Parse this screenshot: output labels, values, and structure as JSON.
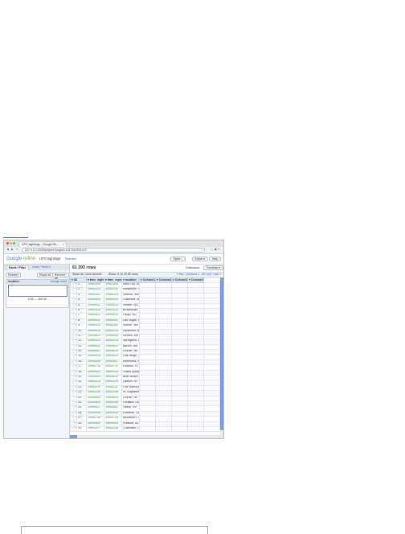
{
  "browser": {
    "tab_title": "UFO sightings - Google Re...",
    "url": "127.0.0.1:3333/project?project=1417510931470"
  },
  "app": {
    "brand_google": "Google",
    "brand_refine": "refine",
    "project_name": "UFO sightings",
    "permalink": "Permalink",
    "buttons": {
      "open": "Open...",
      "export": "Export ▾",
      "help": "Help"
    }
  },
  "left": {
    "tabs": [
      "Facet / Filter",
      "Undo / Redo 0"
    ],
    "refresh": "Refresh",
    "reset_all": "Reset All",
    "remove_all": "Remove All",
    "facet": {
      "title": "location",
      "links": "change  reset",
      "range": "0.00 — 400.00"
    }
  },
  "main": {
    "rows_count": "61 393 rows",
    "view_buttons": [
      "Extensions:",
      "Freebase ▾"
    ],
    "show_as": "Show as: rows records",
    "show_count": "Show: 5 10 25 50 rows",
    "paging": "« first ‹ previous 1 - 50 next › last »",
    "columns": [
      "All",
      "time_sighted",
      "time_reported",
      "location",
      "Column1",
      "Column2",
      "Column3",
      "Column4",
      "Column5"
    ],
    "rows": [
      {
        "n": "1.",
        "sighted": "19951009",
        "reported": "19951009",
        "location": "Iowa City, IA"
      },
      {
        "n": "2.",
        "sighted": "19951010",
        "reported": "19951011",
        "location": "Milwaukee, WI"
      },
      {
        "n": "3.",
        "sighted": "19950101",
        "reported": "19950103",
        "location": "Shelton, WA"
      },
      {
        "n": "4.",
        "sighted": "19950510",
        "reported": "19950510",
        "location": "Columbia, MO"
      },
      {
        "n": "5.",
        "sighted": "19950611",
        "reported": "19950614",
        "location": "Seattle, WA"
      },
      {
        "n": "6.",
        "sighted": "19951025",
        "reported": "19951024",
        "location": "Brownsville, WA"
      },
      {
        "n": "7.",
        "sighted": "19950620",
        "reported": "19950619",
        "location": "Fargo, ND"
      },
      {
        "n": "8.",
        "sighted": "19950911",
        "reported": "19950911",
        "location": "Las Vegas, NV"
      },
      {
        "n": "9.",
        "sighted": "19950115",
        "reported": "19950118",
        "location": "Morton, WA"
      },
      {
        "n": "10.",
        "sighted": "19950915",
        "reported": "19950915",
        "location": "Redmond, WA"
      },
      {
        "n": "11.",
        "sighted": "19950801",
        "reported": "19950804",
        "location": "Renton, WA"
      },
      {
        "n": "12.",
        "sighted": "19950412",
        "reported": "19950413",
        "location": "Springfield, IL"
      },
      {
        "n": "13.",
        "sighted": "19950611",
        "reported": "19950612",
        "location": "Barton, WA"
      },
      {
        "n": "14.",
        "sighted": "19950607",
        "reported": "19950613",
        "location": "Lincoln, NE"
      },
      {
        "n": "15.",
        "sighted": "19950619",
        "reported": "19950619",
        "location": "Oak Ridge, TN"
      },
      {
        "n": "16.",
        "sighted": "19950505",
        "reported": "19950507",
        "location": "Richmond, VA"
      },
      {
        "n": "17.",
        "sighted": "19950710",
        "reported": "19950711",
        "location": "Orlando, FL"
      },
      {
        "n": "18.",
        "sighted": "19950513",
        "reported": "19950515",
        "location": "Grand Spring, ID"
      },
      {
        "n": "19.",
        "sighted": "19950531",
        "reported": "19950610",
        "location": "Bear Beach, CA"
      },
      {
        "n": "20.",
        "sighted": "19950224",
        "reported": "19950224",
        "location": "Lawton, NY"
      },
      {
        "n": "21.",
        "sighted": "19950210",
        "reported": "19950211",
        "location": "Fort Myers Beach, FL"
      },
      {
        "n": "22.",
        "sighted": "19951108",
        "reported": "19951108",
        "location": "St. Augustine, FL"
      },
      {
        "n": "23.",
        "sighted": "19950813",
        "reported": "19950819",
        "location": "Lincoln, NE"
      },
      {
        "n": "24.",
        "sighted": "19950529",
        "reported": "19950530",
        "location": "Portland, OR"
      },
      {
        "n": "25.",
        "sighted": "19950621",
        "reported": "19950621",
        "location": "Hilltop, NV"
      },
      {
        "n": "26.",
        "sighted": "19950908",
        "reported": "19950910",
        "location": "Lebanon, OR"
      },
      {
        "n": "27.",
        "sighted": "19950708",
        "reported": "19950709",
        "location": "Woodburn, OR"
      },
      {
        "n": "28.",
        "sighted": "19950503",
        "reported": "19950503",
        "location": "Prescott, AZ"
      },
      {
        "n": "29.",
        "sighted": "19950227",
        "reported": "19950228",
        "location": "Coldwater, OH"
      }
    ]
  },
  "colors": {
    "accent": "#3b63b5",
    "date_green": "#2e8b2e",
    "header_blue": "#dde5f3",
    "scroll_blue": "#7f9cd2"
  }
}
